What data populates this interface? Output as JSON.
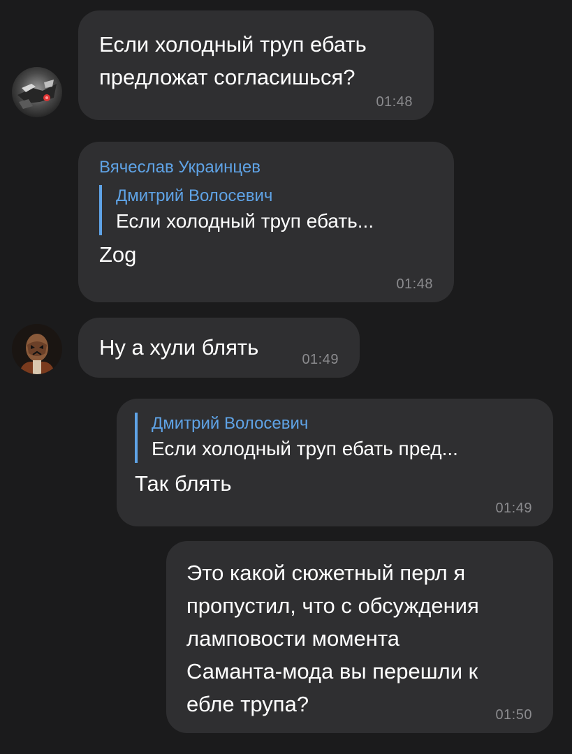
{
  "messages": [
    {
      "text": "Если холодный труп ебать\nпредложат согласишься?",
      "time": "01:48"
    },
    {
      "sender": "Вячеслав Украинцев",
      "reply_name": "Дмитрий Волосевич",
      "reply_text": "Если холодный труп ебать...",
      "text": "Zog",
      "time": "01:48"
    },
    {
      "text": "Ну а хули блять",
      "time": "01:49"
    },
    {
      "reply_name": "Дмитрий Волосевич",
      "reply_text": "Если холодный труп ебать пред...",
      "text": "Так блять",
      "time": "01:49"
    },
    {
      "text": "Это какой сюжетный перл я\nпропустил, что с обсуждения\nламповости момента\nСаманта-мода вы перешли к\nебле трупа?",
      "time": "01:50"
    }
  ],
  "colors": {
    "background": "#1b1b1c",
    "bubble": "#2f2f31",
    "accent_name": "#5fa3e6",
    "timestamp": "#8b8b8e"
  },
  "icons": {
    "avatar_1": "robot-avatar-icon",
    "avatar_2": "masked-person-avatar-icon"
  }
}
